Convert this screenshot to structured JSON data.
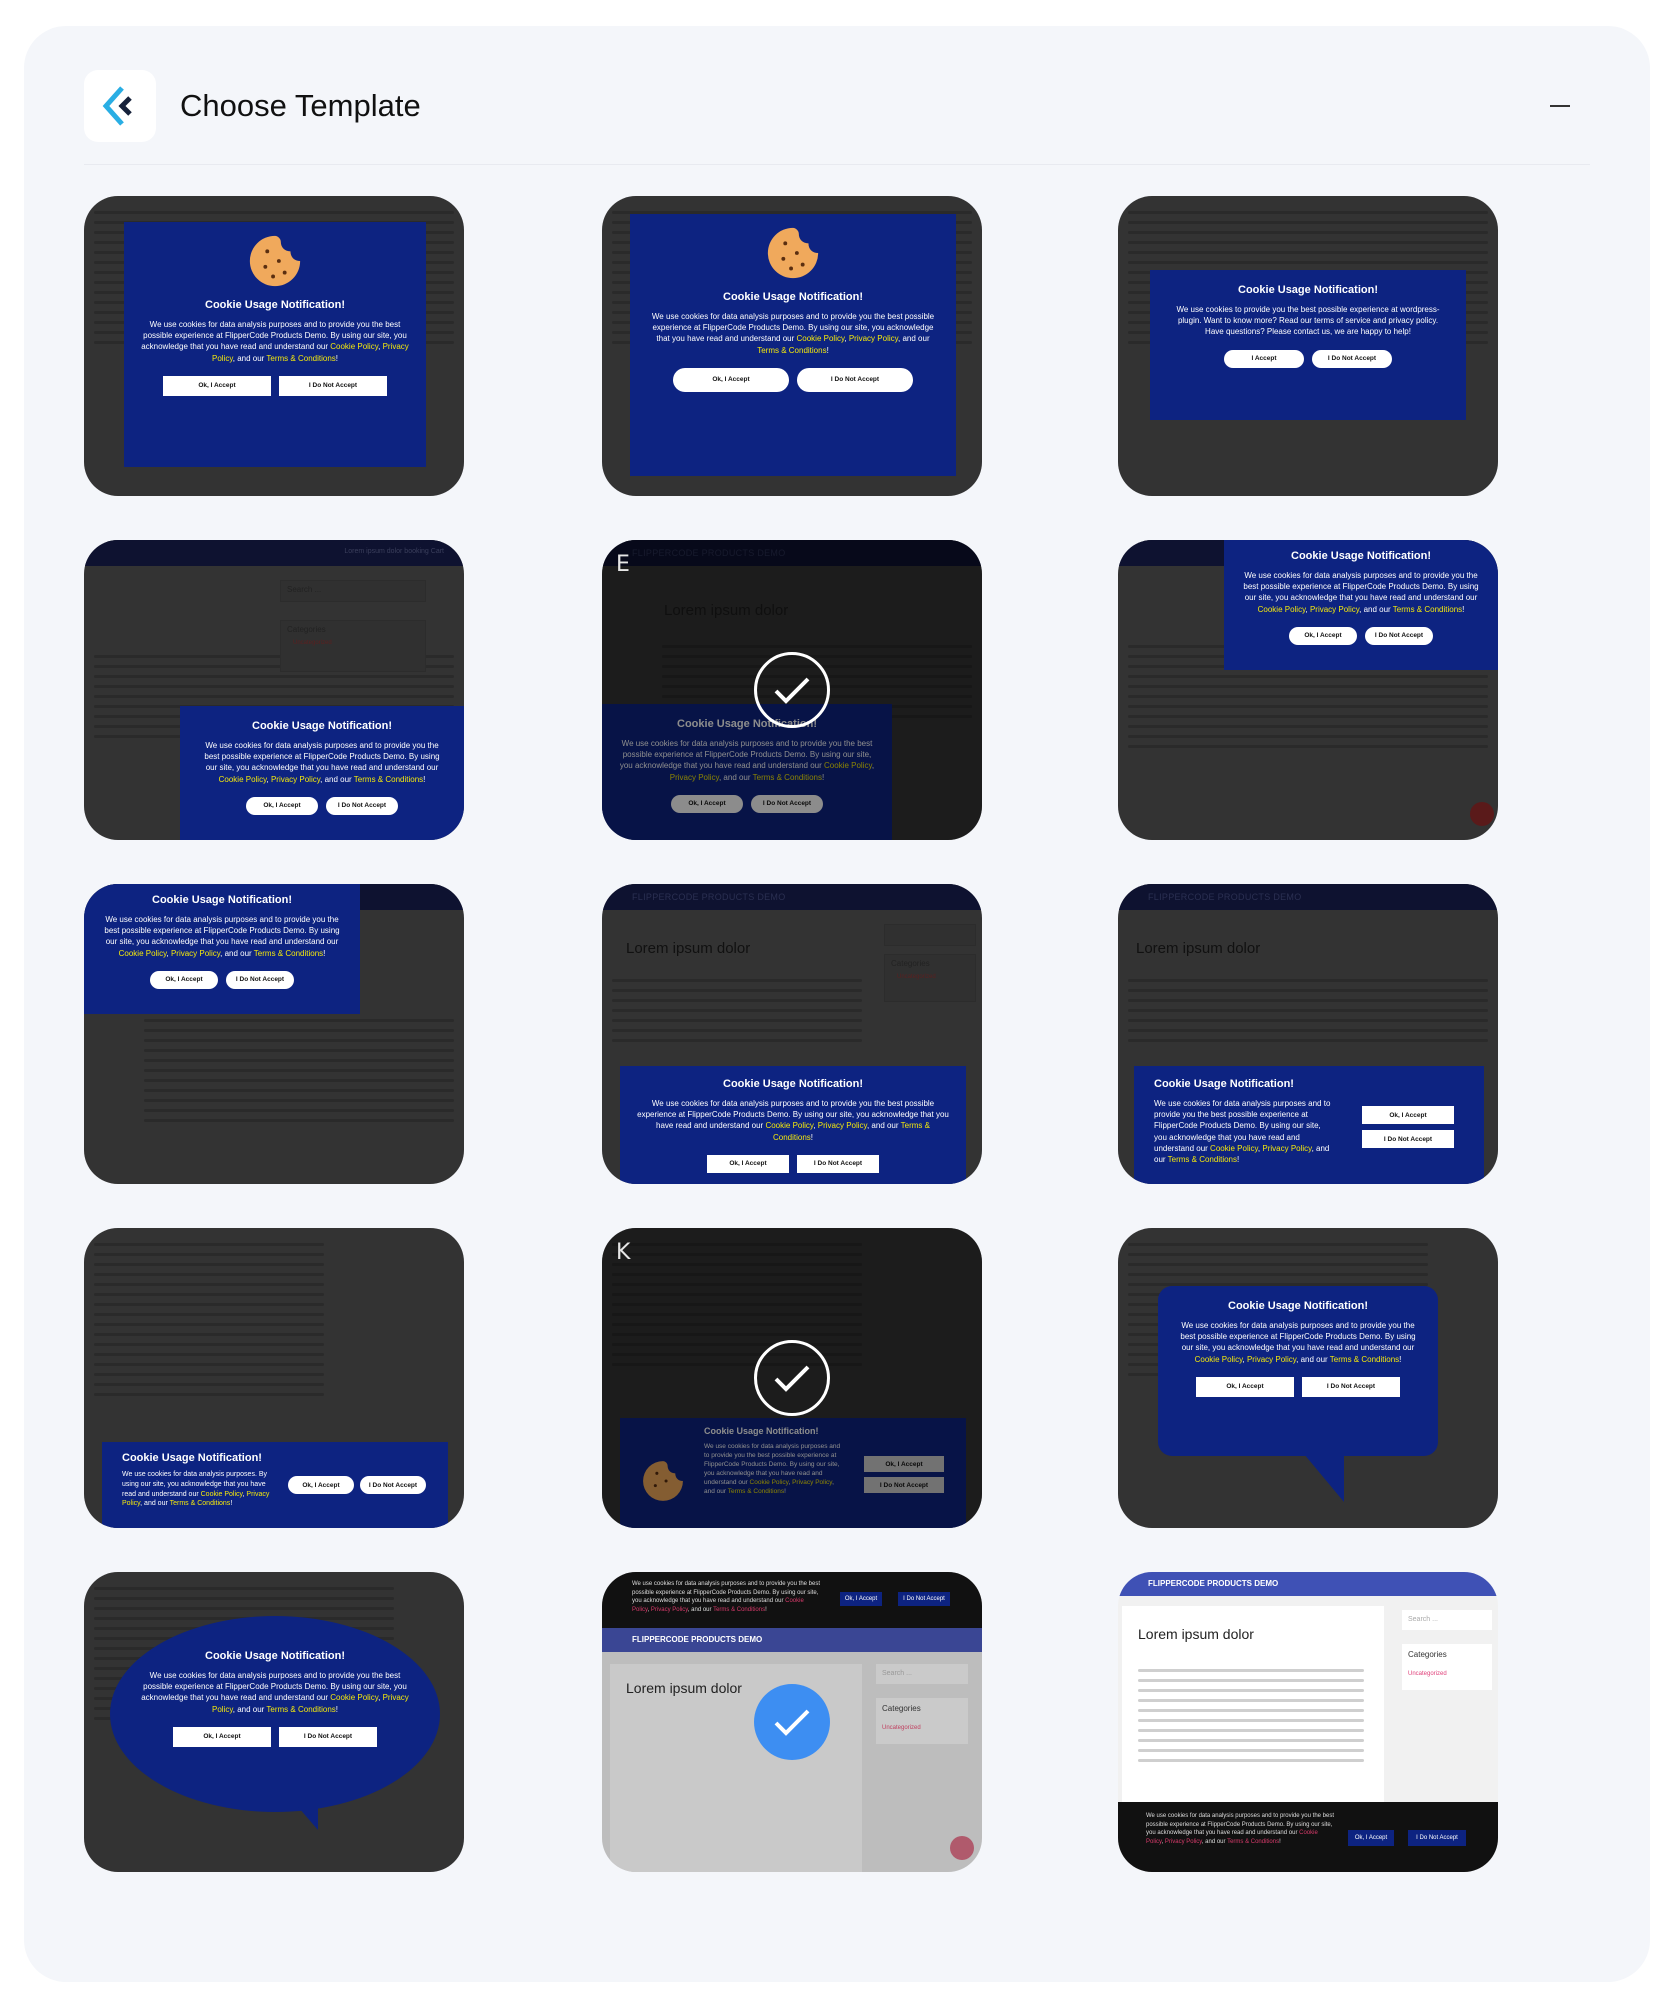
{
  "header": {
    "title": "Choose Template",
    "logo_icon": "flippercode-logo-icon",
    "minimize_icon": "minimize-icon"
  },
  "popup": {
    "heading": "Cookie Usage Notification!",
    "text_a": "We use cookies for data analysis purposes and to provide you the best possible experience at FlipperCode Products Demo. By using our site, you acknowledge that you have read and understand our ",
    "text_short": "We use cookies for data analysis purposes. By using our site, you acknowledge that you have read and understand our ",
    "link_cookie": "Cookie Policy",
    "sep1": ", ",
    "link_privacy": "Privacy Policy",
    "sep2": ", and our ",
    "link_terms": "Terms & Conditions",
    "end": "!",
    "accept": "Ok, I Accept",
    "decline": "I Do Not Accept",
    "alt_text": "We use cookies to provide you the best possible experience at wordpress-plugin. Want to know more? Read our terms of service and privacy policy. Have questions? Please contact us, we are happy to help!",
    "alt_accept": "I Accept",
    "alt_decline": "I Do Not Accept"
  },
  "site": {
    "brand": "FLIPPERCODE PRODUCTS DEMO",
    "heading": "Lorem ipsum dolor",
    "nav": "Lorem ipsum dolor    booking    Cart",
    "search_placeholder": "Search ...",
    "categories": "Categories",
    "uncategorized": "Uncategorized"
  },
  "templates": [
    {
      "id": "template-1",
      "style": "modal-cookie",
      "selected": false
    },
    {
      "id": "template-2",
      "style": "modal-cookie-rounded",
      "selected": false
    },
    {
      "id": "template-3",
      "style": "modal-wordpress",
      "selected": false
    },
    {
      "id": "template-4",
      "style": "bottom-right-box",
      "selected": false
    },
    {
      "id": "template-5",
      "style": "bottom-left-box",
      "selected": true,
      "badge": "E"
    },
    {
      "id": "template-6",
      "style": "top-right-box",
      "selected": false
    },
    {
      "id": "template-7",
      "style": "top-left-box",
      "selected": false
    },
    {
      "id": "template-8",
      "style": "bottom-center-bar",
      "selected": false
    },
    {
      "id": "template-9",
      "style": "bottom-split-bar",
      "selected": false
    },
    {
      "id": "template-10",
      "style": "bottom-inline-bar",
      "selected": false
    },
    {
      "id": "template-11",
      "style": "bottom-cookie-bar",
      "selected": true,
      "badge": "K"
    },
    {
      "id": "template-12",
      "style": "speech-bubble",
      "selected": false
    },
    {
      "id": "template-13",
      "style": "oval-bubble",
      "selected": false
    },
    {
      "id": "template-14",
      "style": "top-black-bar",
      "selected": true,
      "badge": ""
    },
    {
      "id": "template-15",
      "style": "bottom-black-bar",
      "selected": false
    }
  ]
}
